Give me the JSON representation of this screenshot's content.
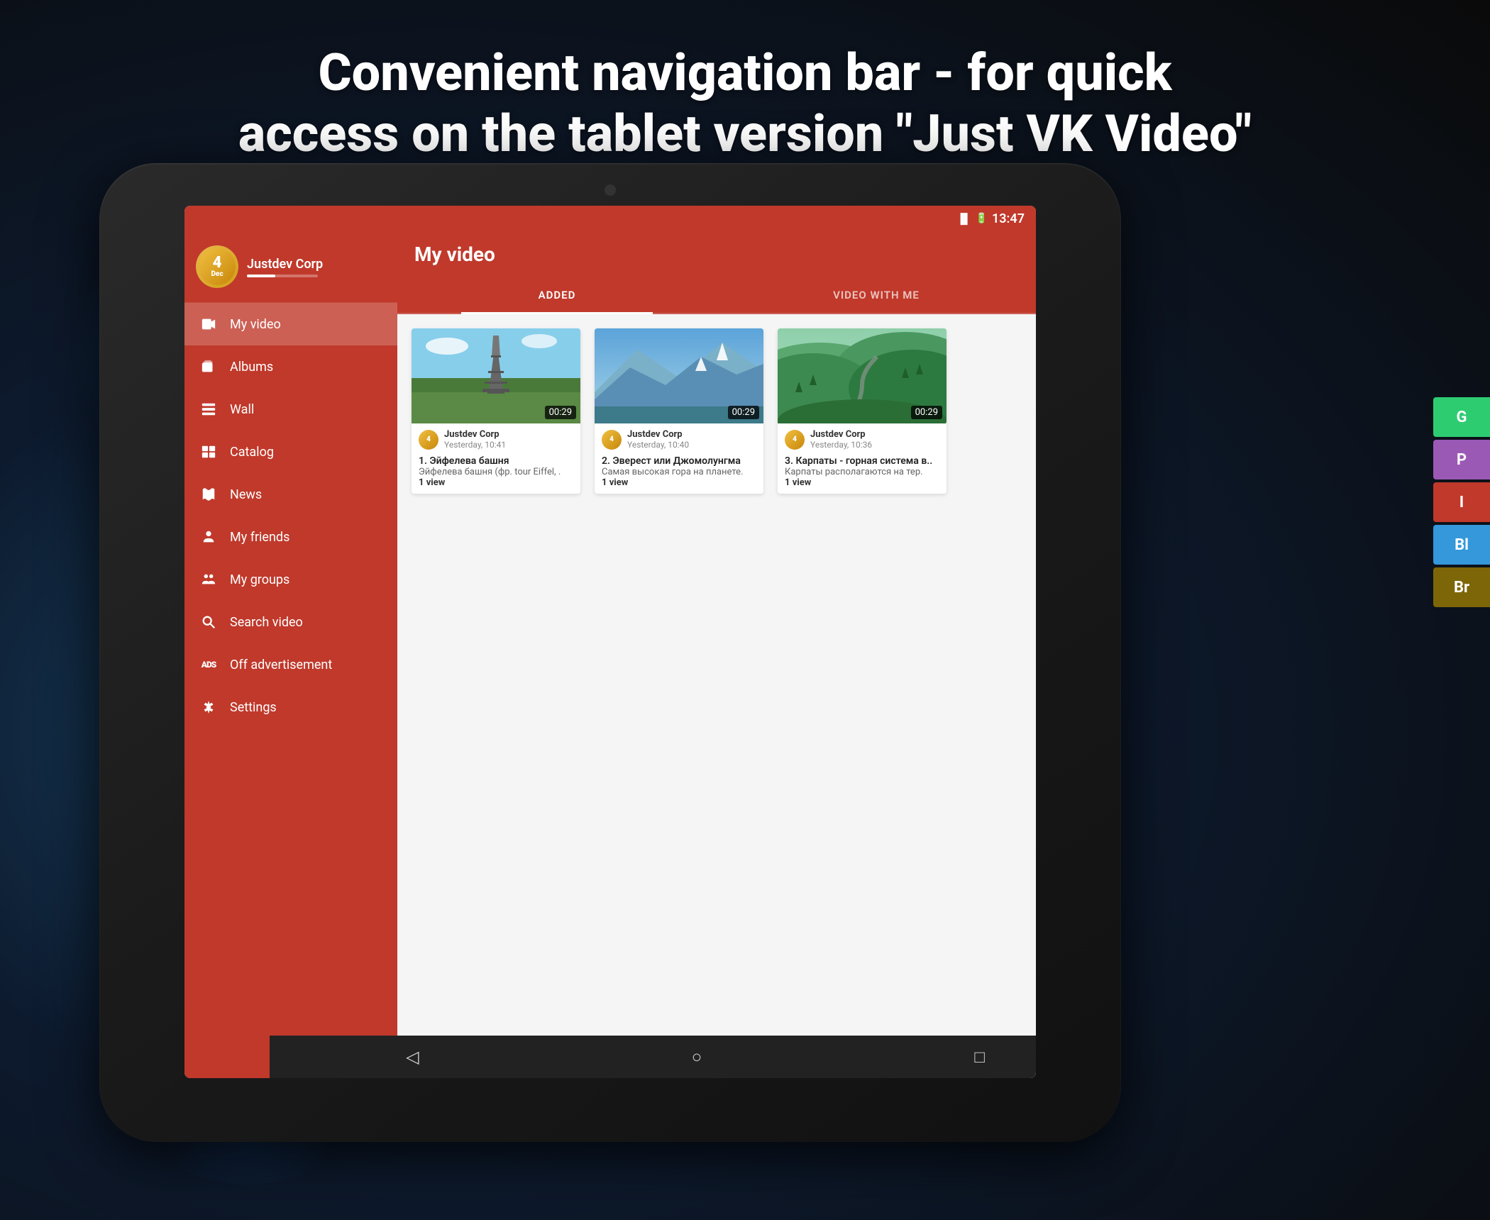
{
  "page": {
    "title_line1": "Convenient navigation bar - for quick",
    "title_line2": "access on the tablet version \"Just VK Video\""
  },
  "status_bar": {
    "time": "13:47"
  },
  "sidebar": {
    "user_name": "Justdev Corp",
    "avatar_number": "4",
    "avatar_sub": "Dec",
    "nav_items": [
      {
        "id": "my-video",
        "label": "My video",
        "active": true
      },
      {
        "id": "albums",
        "label": "Albums",
        "active": false
      },
      {
        "id": "wall",
        "label": "Wall",
        "active": false
      },
      {
        "id": "catalog",
        "label": "Catalog",
        "active": false
      },
      {
        "id": "news",
        "label": "News",
        "active": false
      },
      {
        "id": "my-friends",
        "label": "My friends",
        "active": false
      },
      {
        "id": "my-groups",
        "label": "My groups",
        "active": false
      },
      {
        "id": "search-video",
        "label": "Search video",
        "active": false
      },
      {
        "id": "off-advertisement",
        "label": "Off advertisement",
        "active": false
      },
      {
        "id": "settings",
        "label": "Settings",
        "active": false
      }
    ]
  },
  "main": {
    "title": "My video",
    "tabs": [
      {
        "id": "added",
        "label": "ADDED",
        "active": true
      },
      {
        "id": "video-with-me",
        "label": "VIDEO WITH ME",
        "active": false
      }
    ],
    "videos": [
      {
        "id": 1,
        "user": "Justdev Corp",
        "date": "Yesterday, 10:41",
        "duration": "00:29",
        "title": "1. Эйфелева башня",
        "desc": "Эйфелева башня (фр. tour Eiffel, .",
        "views": "1 view",
        "thumb_type": "eiffel"
      },
      {
        "id": 2,
        "user": "Justdev Corp",
        "date": "Yesterday, 10:40",
        "duration": "00:29",
        "title": "2. Эверест или Джомолунгма",
        "desc": "Самая высокая гора на планете.",
        "views": "1 view",
        "thumb_type": "mountain"
      },
      {
        "id": 3,
        "user": "Justdev Corp",
        "date": "Yesterday, 10:36",
        "duration": "00:29",
        "title": "3. Карпаты - горная система в..",
        "desc": "Карпаты располагаются на тер.",
        "views": "1 view",
        "thumb_type": "valley"
      }
    ]
  },
  "side_tabs": [
    {
      "id": "G",
      "label": "G",
      "color": "#2ecc71"
    },
    {
      "id": "P",
      "label": "P",
      "color": "#9b59b6"
    },
    {
      "id": "I",
      "label": "I",
      "color": "#c0392b"
    },
    {
      "id": "Bl",
      "label": "Bl",
      "color": "#3498db"
    },
    {
      "id": "Br",
      "label": "Br",
      "color": "#7d6608"
    }
  ],
  "android_nav": {
    "back": "◁",
    "home": "○",
    "recent": "□"
  }
}
